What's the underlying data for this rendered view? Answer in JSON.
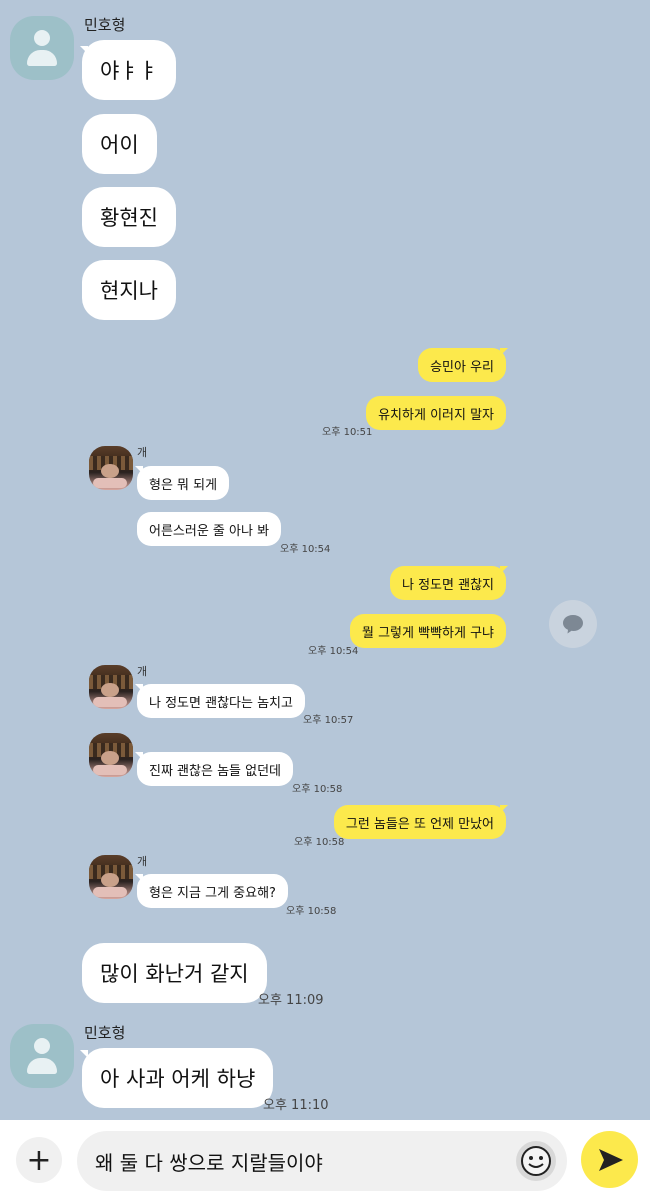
{
  "chat": {
    "sender_main": "민호형",
    "sender_second": "개",
    "messages": {
      "m1": "야ㅑㅑ",
      "m2": "어이",
      "m3": "황현진",
      "m4": "현지나",
      "m5": "승민아 우리",
      "m6": "유치하게 이러지 말자",
      "t6": "오후 10:51",
      "m7": "형은 뭐 되게",
      "m8": "어른스러운 줄 아나 봐",
      "t8": "오후 10:54",
      "m9": "나 정도면 괜찮지",
      "m10": "뭘 그렇게 빡빡하게 구냐",
      "t10": "오후 10:54",
      "m11": "나 정도면 괜찮다는 놈치고",
      "t11": "오후 10:57",
      "m12": "진짜 괜찮은 놈들 없던데",
      "t12": "오후 10:58",
      "m13": "그런 놈들은 또 언제 만났어",
      "t13": "오후 10:58",
      "m14": "형은 지금 그게 중요해?",
      "t14": "오후 10:58",
      "m15": "많이 화난거 같지",
      "t15": "오후 11:09",
      "m16": "아 사과 어케 하냥",
      "t16": "오후 11:10"
    }
  },
  "composer": {
    "input_text": "왜 둘 다 쌍으로 지랄들이야",
    "plus_icon": "+"
  },
  "icons": {
    "share": "share-chat-icon",
    "emoji": "emoji-icon",
    "send": "send-icon",
    "plus": "plus-icon",
    "avatar_default": "default-avatar-icon"
  },
  "colors": {
    "background": "#b5c6d8",
    "my_bubble": "#fce94c",
    "other_bubble": "#ffffff"
  }
}
